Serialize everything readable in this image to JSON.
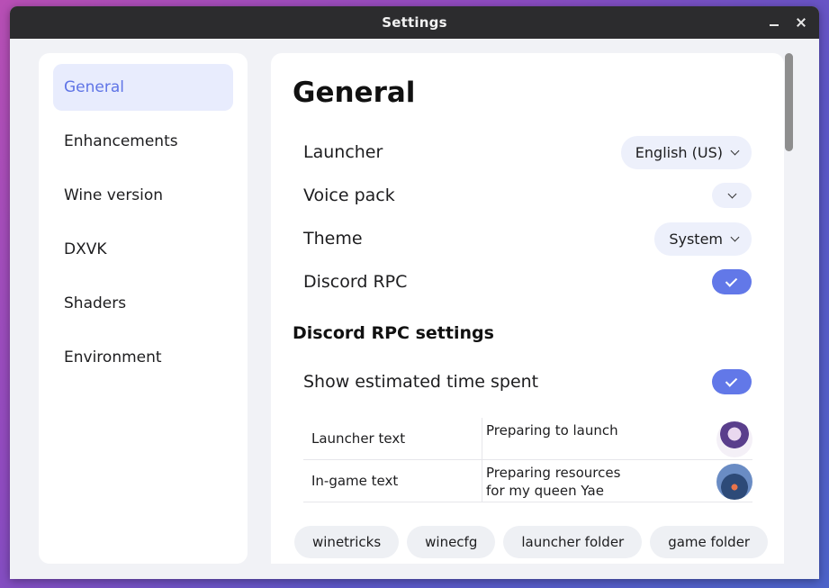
{
  "window": {
    "title": "Settings",
    "minimize_icon": "minimize-icon",
    "close_icon": "close-icon"
  },
  "sidebar": {
    "items": [
      {
        "label": "General",
        "active": true
      },
      {
        "label": "Enhancements"
      },
      {
        "label": "Wine version"
      },
      {
        "label": "DXVK"
      },
      {
        "label": "Shaders"
      },
      {
        "label": "Environment"
      }
    ]
  },
  "main": {
    "title": "General",
    "rows": {
      "launcher": {
        "label": "Launcher",
        "value": "English (US)"
      },
      "voice_pack": {
        "label": "Voice pack",
        "value": ""
      },
      "theme": {
        "label": "Theme",
        "value": "System"
      },
      "discord_rpc": {
        "label": "Discord RPC",
        "checked": true
      }
    },
    "discord_section": {
      "title": "Discord RPC settings",
      "show_time": {
        "label": "Show estimated time spent",
        "checked": true
      },
      "table": [
        {
          "label": "Launcher text",
          "value": "Preparing to launch",
          "image": "launcher-avatar"
        },
        {
          "label": "In-game text",
          "value": "Preparing resources for my queen Yae",
          "image": "ingame-avatar"
        }
      ]
    },
    "buttons": [
      "winetricks",
      "winecfg",
      "launcher folder",
      "game folder"
    ]
  },
  "colors": {
    "accent": "#6278e8",
    "active_bg": "#e8ecfd",
    "titlebar": "#2c2c2e"
  }
}
